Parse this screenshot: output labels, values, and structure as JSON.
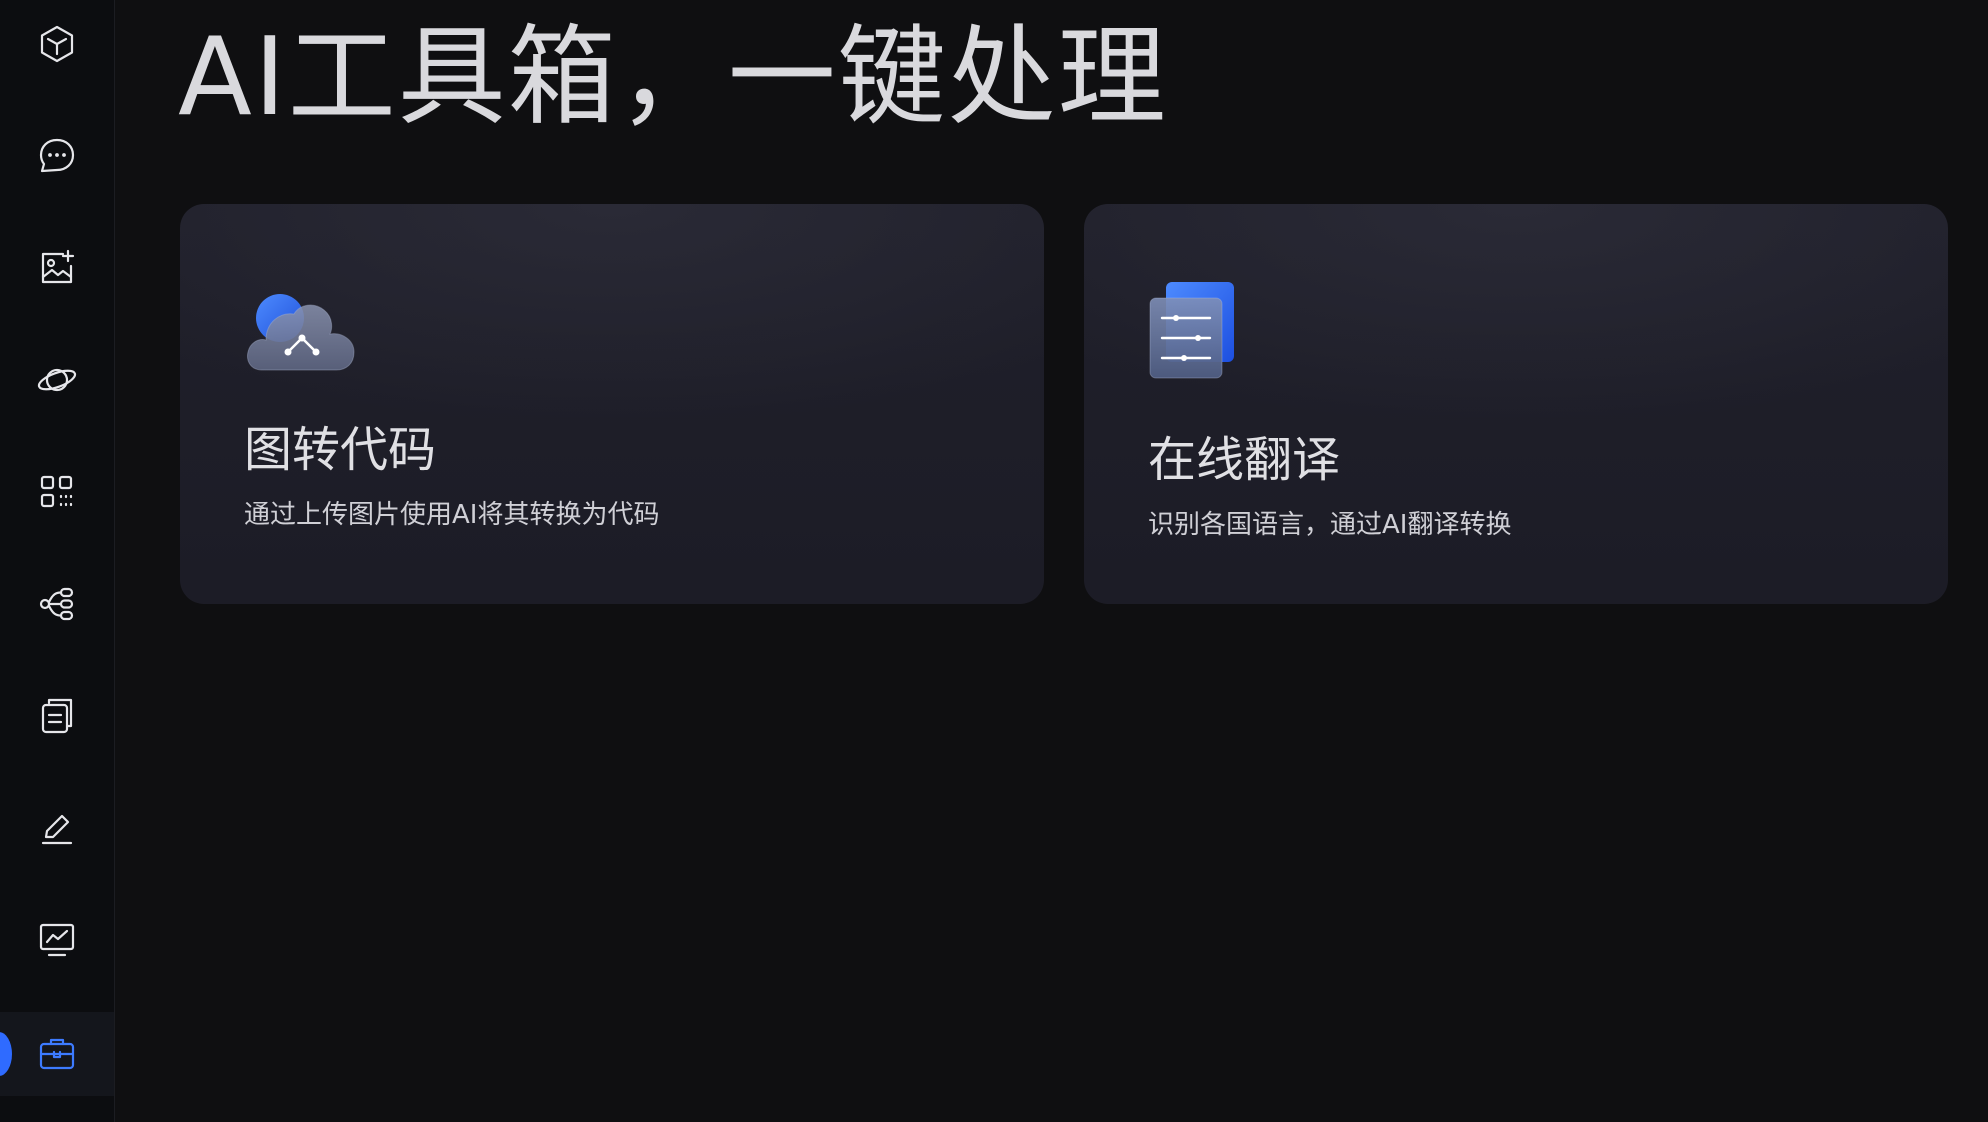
{
  "header": {
    "title": "AI工具箱，一键处理"
  },
  "sidebar": {
    "items": [
      {
        "name": "cube-icon",
        "active": false
      },
      {
        "name": "chat-bubble-icon",
        "active": false
      },
      {
        "name": "image-add-icon",
        "active": false
      },
      {
        "name": "planet-icon",
        "active": false
      },
      {
        "name": "apps-grid-icon",
        "active": false
      },
      {
        "name": "mind-map-icon",
        "active": false
      },
      {
        "name": "documents-icon",
        "active": false
      },
      {
        "name": "edit-pen-icon",
        "active": false
      },
      {
        "name": "monitor-chart-icon",
        "active": false
      },
      {
        "name": "toolbox-icon",
        "active": true
      }
    ],
    "accent_color": "#3d7bff"
  },
  "tools": [
    {
      "title": "图转代码",
      "description": "通过上传图片使用AI将其转换为代码",
      "icon": "cloud-code-icon"
    },
    {
      "title": "在线翻译",
      "description": "识别各国语言，通过AI翻译转换",
      "icon": "document-translate-icon"
    }
  ],
  "colors": {
    "background": "#0f0f11",
    "card": "#1e1e28",
    "accent": "#2f6bff"
  }
}
